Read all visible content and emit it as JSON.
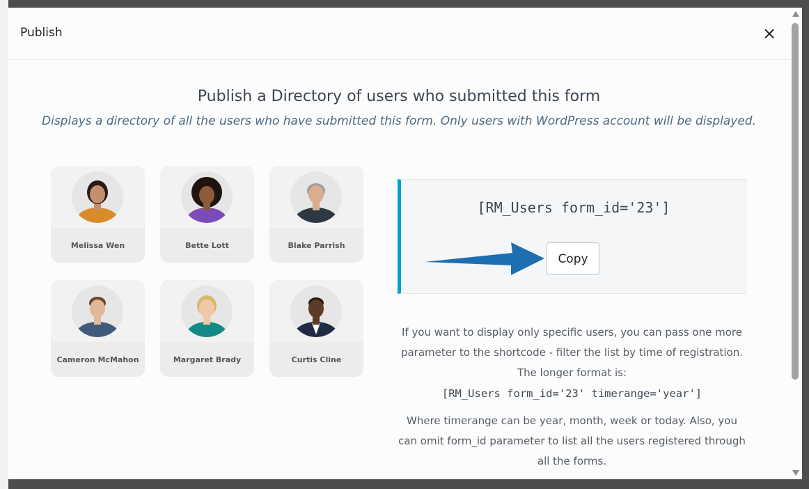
{
  "modal": {
    "title": "Publish",
    "close_label": "×"
  },
  "heading": "Publish a Directory of users who submitted this form",
  "subheading": "Displays a directory of all the users who have submitted this form. Only users with WordPress account will be displayed.",
  "users": [
    {
      "name": "Melissa Wen",
      "skin": "#c48f6d",
      "shirt": "#d98b2b",
      "hair": "#2b1a12"
    },
    {
      "name": "Bette Lott",
      "skin": "#8c5b3e",
      "shirt": "#7b4bb8",
      "hair": "#1f1410"
    },
    {
      "name": "Blake Parrish",
      "skin": "#d9ad8e",
      "shirt": "#2e3742",
      "hair": "#9e9e9e"
    },
    {
      "name": "Cameron McMahon",
      "skin": "#e3b79a",
      "shirt": "#3f5a7a",
      "hair": "#6b4a2b"
    },
    {
      "name": "Margaret Brady",
      "skin": "#f0c8a8",
      "shirt": "#138a85",
      "hair": "#d9b870"
    },
    {
      "name": "Curtis Cline",
      "skin": "#5c3b28",
      "shirt": "#1f2a44",
      "hair": "#2a1a12"
    }
  ],
  "shortcode": {
    "code": "[RM_Users form_id='23']",
    "copy_label": "Copy",
    "accent": "#00a0d2",
    "arrow_color": "#1d6fb0"
  },
  "info": {
    "paragraph1": "If you want to display only specific users, you can pass one more parameter to the shortcode - filter the list by time of registration. The longer format is:",
    "long_code": "[RM_Users form_id='23' timerange='year']",
    "paragraph2": "Where timerange can be year, month, week or today. Also, you can omit form_id parameter to list all the users registered through all the forms."
  }
}
